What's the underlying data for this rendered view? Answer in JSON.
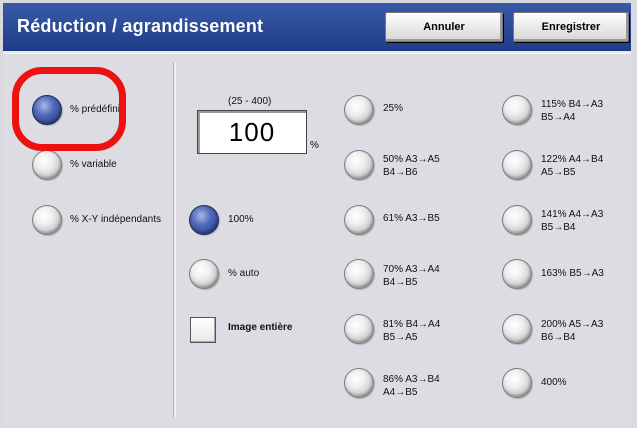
{
  "header": {
    "title": "Réduction / agrandissement",
    "cancel_label": "Annuler",
    "save_label": "Enregistrer"
  },
  "modes": [
    {
      "label": "% prédéfini",
      "selected": true
    },
    {
      "label": "% variable",
      "selected": false
    },
    {
      "label": "% X-Y indépendants",
      "selected": false
    }
  ],
  "value": {
    "range": "(25 - 400)",
    "current": "100",
    "unit": "%"
  },
  "options": {
    "opt100": "100%",
    "auto": "% auto",
    "image_entiere": "Image entière"
  },
  "presets_col1": [
    {
      "line1": "25%",
      "line2": ""
    },
    {
      "line1": "50% A3→A5",
      "line2": "B4→B6"
    },
    {
      "line1": "61% A3→B5",
      "line2": ""
    },
    {
      "line1": "70% A3→A4",
      "line2": "B4→B5"
    },
    {
      "line1": "81% B4→A4",
      "line2": "B5→A5"
    },
    {
      "line1": "86% A3→B4",
      "line2": "A4→B5"
    }
  ],
  "presets_col2": [
    {
      "line1": "115% B4→A3",
      "line2": "B5→A4"
    },
    {
      "line1": "122% A4→B4",
      "line2": "A5→B5"
    },
    {
      "line1": "141% A4→A3",
      "line2": "B5→B4"
    },
    {
      "line1": "163% B5→A3",
      "line2": ""
    },
    {
      "line1": "200% A5→A3",
      "line2": "B6→B4"
    },
    {
      "line1": "400%",
      "line2": ""
    }
  ],
  "colors": {
    "header_bg": "#2a4a9a",
    "selected_radio": "#3a56a8",
    "highlight": "#ee1111"
  }
}
